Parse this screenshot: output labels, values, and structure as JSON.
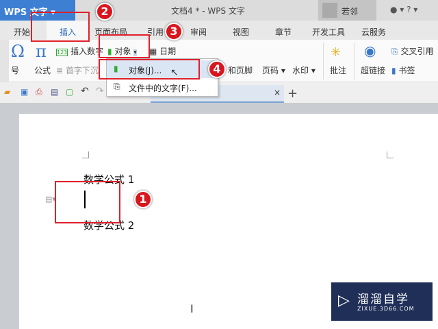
{
  "titlebar": {
    "app_button": "WPS 文字",
    "doc_title": "文档4 * - WPS 文字",
    "user": "若邻"
  },
  "tabs": [
    "开始",
    "插入",
    "页面布局",
    "引用",
    "审阅",
    "视图",
    "章节",
    "开发工具",
    "云服务"
  ],
  "ribbon": {
    "symbol": "号",
    "formula": "公式",
    "insert_number": "插入数字",
    "drop_cap": "首字下沉",
    "object": "对象",
    "date": "日期",
    "header_footer": "和页脚",
    "page_number": "页码",
    "watermark": "水印",
    "comment": "批注",
    "hyperlink": "超链接",
    "cross_ref": "交叉引用",
    "bookmark": "书签"
  },
  "menu": {
    "items": [
      "对象(J)...",
      "文件中的文字(F)..."
    ]
  },
  "doc_tab": {
    "close": "×",
    "add": "+"
  },
  "document": {
    "lines": [
      "数学公式 1",
      "数学公式 2"
    ]
  },
  "steps": [
    "1",
    "2",
    "3",
    "4"
  ],
  "watermark_logo": {
    "name": "溜溜自学",
    "url": "ZIXUE.3D66.COM"
  },
  "colors": {
    "accent": "#3d7fd3",
    "highlight": "#e0202a"
  }
}
